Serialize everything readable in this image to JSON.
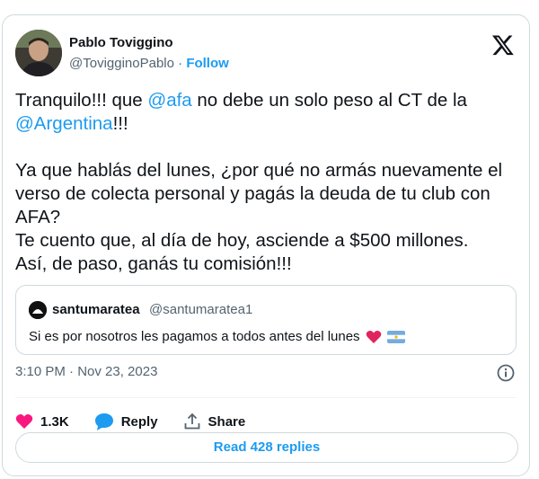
{
  "author": {
    "name": "Pablo Toviggino",
    "handle": "@TovigginoPablo",
    "separator": "·",
    "follow_label": "Follow"
  },
  "tweet": {
    "p1_a": "Tranquilo!!! que ",
    "p1_mention1": "@afa",
    "p1_b": " no debe un solo peso al CT de la ",
    "p1_mention2": "@Argentina",
    "p1_c": "!!!",
    "p2": "Ya que hablás del lunes, ¿por qué no armás nuevamente el verso de colecta personal y pagás la deuda de tu club con AFA?",
    "p3": "Te cuento que, al día de hoy, asciende a $500 millones.",
    "p4": "Así, de paso, ganás tu comisión!!!"
  },
  "quote": {
    "name": "santumaratea",
    "handle": "@santumaratea1",
    "text": "Si es por nosotros les pagamos a todos antes del lunes"
  },
  "timestamp": "3:10 PM · Nov 23, 2023",
  "actions": {
    "likes": "1.3K",
    "reply_label": "Reply",
    "share_label": "Share"
  },
  "read_replies_label": "Read 428 replies",
  "colors": {
    "accent": "#1d9bf0",
    "like": "#f91880",
    "border": "#cfd9de",
    "muted": "#536471"
  },
  "icons": [
    "x-logo-icon",
    "info-icon",
    "heart-icon",
    "reply-bubble-icon",
    "share-icon",
    "red-heart-emoji",
    "argentina-flag-emoji"
  ]
}
